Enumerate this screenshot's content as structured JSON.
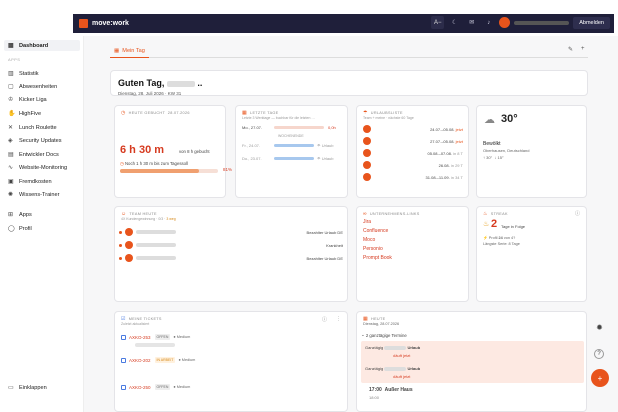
{
  "topbar": {
    "logo": "move:work",
    "font_btn": "A−",
    "logout": "Abmelden"
  },
  "sidebar": {
    "dashboard": "Dashboard",
    "section": "APPS",
    "items": [
      "Statistik",
      "Abwesenheiten",
      "Kicker Liga",
      "HighFive",
      "Lunch Roulette",
      "Security Updates",
      "Entwickler Docs",
      "Website-Monitoring",
      "Fremdkosten",
      "Wissens-Trainer"
    ],
    "apps": "Apps",
    "profil": "Profil",
    "collapse": "Einklappen"
  },
  "tab": {
    "label": "Mein Tag"
  },
  "greeting": {
    "title": "Guten Tag,",
    "date": "Dienstag, 28. Juli 2026 · KW 31"
  },
  "booked": {
    "title": "HEUTE GEBUCHT",
    "date": "28.07.2026",
    "value": "6 h 30 m",
    "of": "von 8 h gebucht",
    "remaining": "Noch 1 h 30 m bis zum Tagessoll",
    "percent_text": "81%",
    "percent": 81
  },
  "days": {
    "title": "LETZTE TAGE",
    "subtitle": "Letzte 3 Werktage — buchbar für die letzten …",
    "rows": [
      {
        "day": "Mo., 27.07.",
        "value": "0,0h"
      },
      {
        "day": "Fr., 24.07.",
        "value": "Urlaub"
      },
      {
        "day": "Do., 23.07.",
        "value": "Urlaub"
      }
    ],
    "weekend": "WOCHENENDE"
  },
  "vacation": {
    "title": "URLAUBSLISTE",
    "subtitle": "Team + meine · nächste 60 Tage",
    "rows": [
      {
        "range": "24.07.–05.08.",
        "tag": "jetzt"
      },
      {
        "range": "27.07.–05.08.",
        "tag": "jetzt"
      },
      {
        "range": "05.08.–07.08.",
        "tag": "in 8 T"
      },
      {
        "range": "26.08.",
        "tag": "in 29 T"
      },
      {
        "range": "31.08.–11.09.",
        "tag": "in 34 T"
      }
    ]
  },
  "weather": {
    "temp": "30°",
    "desc": "Bewölkt",
    "place": "Oberhausen, Deutschland",
    "high": "↑ 30°",
    "low": "↓ 15°"
  },
  "team": {
    "title": "TEAM HEUTE",
    "subtitle": "4X Kundengewinnung · 0/3 ·",
    "warn": "3 weg",
    "rows": [
      {
        "status": "Bezahlter Urlaub DE"
      },
      {
        "status": "Krankheit"
      },
      {
        "status": "Bezahlter Urlaub DE"
      }
    ]
  },
  "links": {
    "title": "UNTERNEHMENS-LINKS",
    "items": [
      "Jira",
      "Confluence",
      "Moco",
      "Personio",
      "Prompt Book"
    ]
  },
  "streak": {
    "title": "STREAK",
    "value": "2",
    "unit": "Tage in Folge",
    "profil_prefix": "Profil",
    "profil_value": "24",
    "profil_suffix": "von 4?",
    "longest": "Längste Serie: 8 Tage"
  },
  "tickets": {
    "title": "MEINE TICKETS",
    "subtitle": "Zuletzt aktualisiert",
    "rows": [
      {
        "key": "AXKO-253",
        "status": "OFFEN",
        "prio": "Medium"
      },
      {
        "key": "AXKO-202",
        "status": "IN ARBEIT",
        "prio": "Medium"
      },
      {
        "key": "AXKO-250",
        "status": "OFFEN",
        "prio": "Medium"
      }
    ]
  },
  "today": {
    "title": "HEUTE",
    "date": "Dienstag, 28.07.2026",
    "allday": "2 ganztägige Termine",
    "events": [
      {
        "label": "Ganztägig",
        "title": "Urlaub",
        "tag": "läuft jetzt"
      },
      {
        "label": "Ganztägig",
        "title": "Urlaub",
        "tag": "läuft jetzt"
      }
    ],
    "next_time": "17:00",
    "next_title": "Außer Haus",
    "next_end": "18:00"
  },
  "colors": {
    "accent": "#e8541c",
    "dark": "#1f1f3a"
  }
}
